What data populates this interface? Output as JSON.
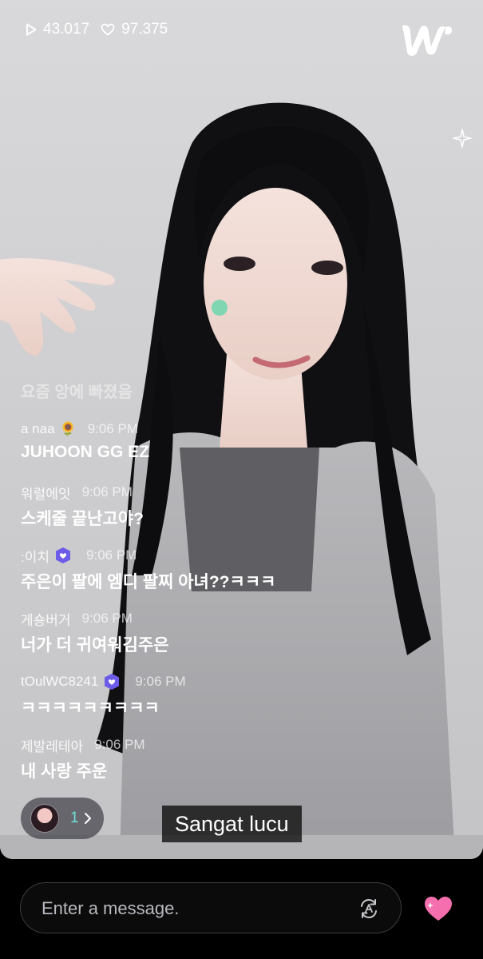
{
  "stats": {
    "plays": "43.017",
    "likes": "97.375"
  },
  "notice": "요즘 앙에 빠졌음",
  "chat": [
    {
      "name": "a naa",
      "emoji": "🌻",
      "badge": false,
      "time": "9:06 PM",
      "text": "JUHOON GG EZ"
    },
    {
      "name": "워럴에잇",
      "emoji": "",
      "badge": false,
      "time": "9:06 PM",
      "text": "스케줄 끝난고야?"
    },
    {
      "name": ":이치",
      "emoji": "",
      "badge": true,
      "time": "9:06 PM",
      "text": "주은이 팔에 엠디 팔찌 아녀??ㅋㅋㅋ"
    },
    {
      "name": "게숑버거",
      "emoji": "",
      "badge": false,
      "time": "9:06 PM",
      "text": "너가 더 귀여워김주은"
    },
    {
      "name": "tOulWC8241",
      "emoji": "",
      "badge": true,
      "time": "9:06 PM",
      "text": "ㅋㅋㅋㅋㅋㅋㅋㅋㅋ"
    },
    {
      "name": "제발레테아",
      "emoji": "",
      "badge": false,
      "time": "9:06 PM",
      "text": "내 사랑 주운"
    }
  ],
  "viewers": {
    "count": "1"
  },
  "caption": "Sangat lucu",
  "input": {
    "placeholder": "Enter a message."
  },
  "colors": {
    "accent": "#6fe0d9",
    "heart": "#f56fae",
    "badge": "#6c5ce7"
  },
  "icons": {
    "play": "play-icon",
    "like": "heart-outline-icon",
    "logo": "weverse-logo",
    "translate": "translate-icon",
    "send_heart": "heart-icon"
  }
}
